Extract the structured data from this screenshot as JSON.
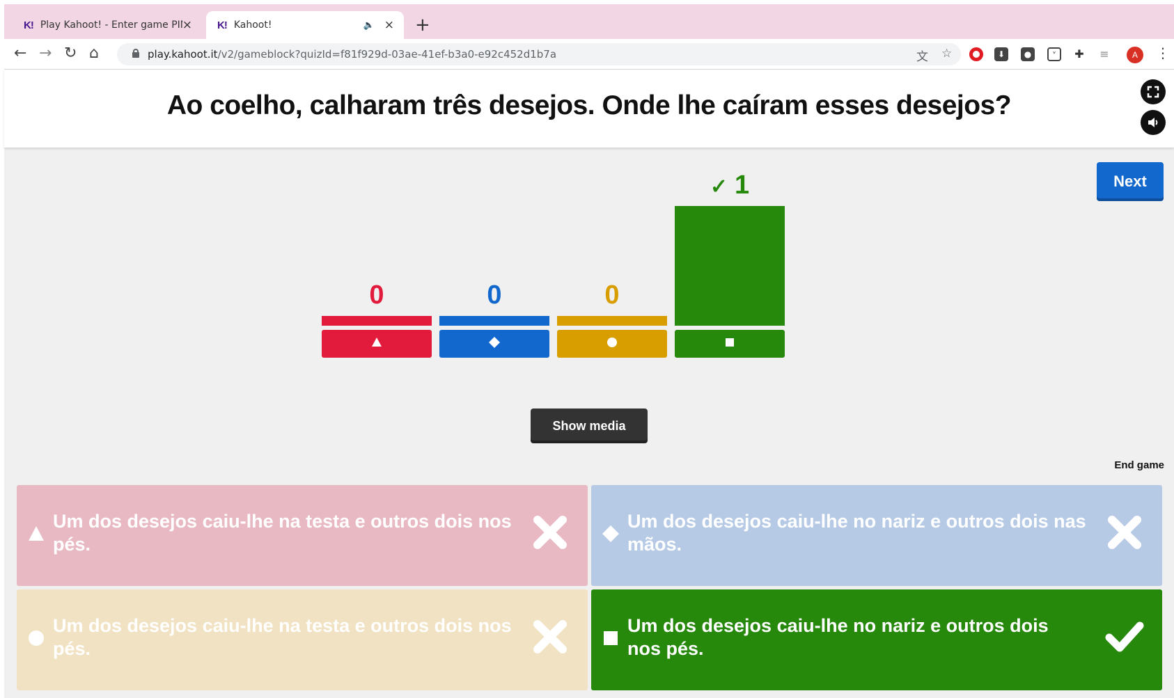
{
  "browser": {
    "tabs": [
      {
        "logo": "K!",
        "title": "Play Kahoot! - Enter game PIN",
        "close": "×"
      },
      {
        "logo": "K!",
        "title": "Kahoot!",
        "close": "×",
        "audio_icon": "speaker-muted-icon"
      }
    ],
    "new_tab": "+",
    "url_host": "play.kahoot.it",
    "url_path": "/v2/gameblock?quizId=f81f929d-03ae-41ef-b3a0-e92c452d1b7a",
    "profile_initial": "A"
  },
  "question": {
    "title": "Ao coelho, calharam três desejos. Onde lhe caíram esses desejos?"
  },
  "controls": {
    "next_label": "Next",
    "show_media_label": "Show media",
    "end_game_label": "End game"
  },
  "chart_data": {
    "type": "bar",
    "categories": [
      "triangle",
      "diamond",
      "circle",
      "square"
    ],
    "values": [
      0,
      0,
      0,
      1
    ],
    "correct": [
      false,
      false,
      false,
      true
    ],
    "colors": [
      "#e21b3c",
      "#1368ce",
      "#d89e00",
      "#26890c"
    ],
    "check_symbol": "✓"
  },
  "answers": [
    {
      "shape": "triangle",
      "text": "Um dos desejos caiu-lhe na testa e outros dois nos pés.",
      "correct": false,
      "color": "#e8b9c3"
    },
    {
      "shape": "diamond",
      "text": "Um dos desejos caiu-lhe no nariz e outros dois nas mãos.",
      "correct": false,
      "color": "#b6cae5"
    },
    {
      "shape": "circle",
      "text": "Um dos desejos caiu-lhe na testa e outros dois nos pés.",
      "correct": false,
      "color": "#f0e2c2"
    },
    {
      "shape": "square",
      "text": "Um dos desejos caiu-lhe no nariz e outros dois nos pés.",
      "correct": true,
      "color": "#26890c"
    }
  ]
}
